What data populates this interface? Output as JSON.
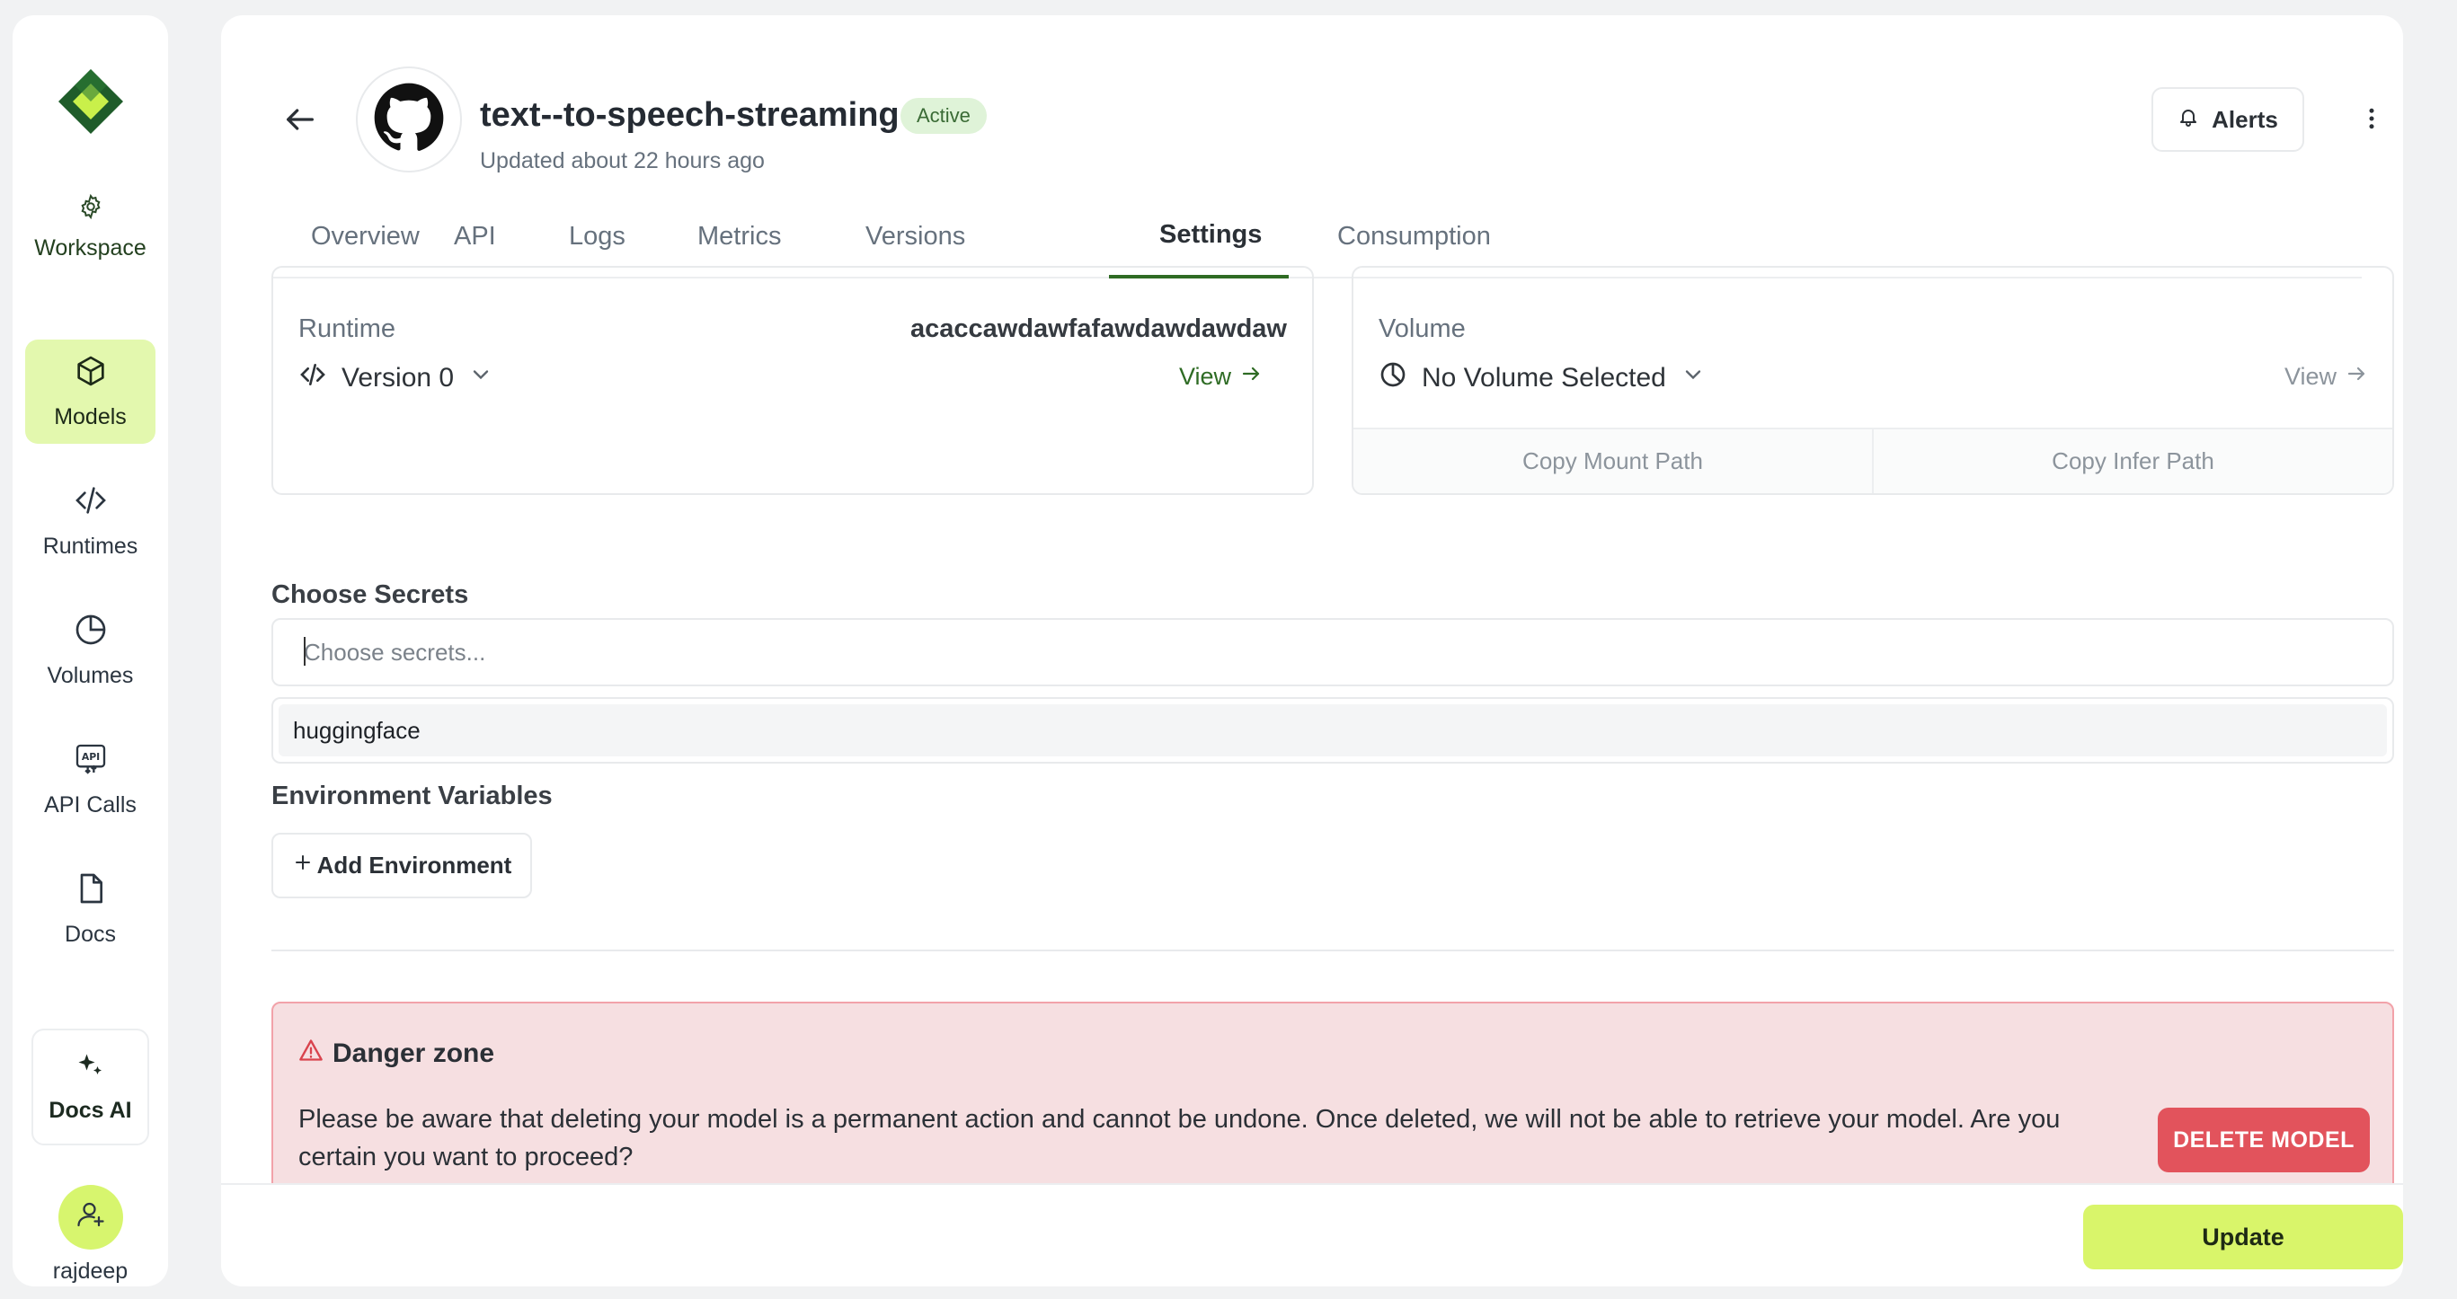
{
  "colors": {
    "accent": "#d9f56a",
    "active_nav_bg": "#e3f8ae",
    "brand_green": "#2f6b24",
    "danger_bg": "#f6dfe1",
    "danger_button": "#e2535c"
  },
  "sidebar": {
    "workspace_label": "Workspace",
    "items": [
      {
        "label": "Models",
        "icon": "cube-icon",
        "active": true
      },
      {
        "label": "Runtimes",
        "icon": "code-icon",
        "active": false
      },
      {
        "label": "Volumes",
        "icon": "pie-chart-icon",
        "active": false
      },
      {
        "label": "API Calls",
        "icon": "api-icon",
        "active": false
      },
      {
        "label": "Docs",
        "icon": "document-icon",
        "active": false
      }
    ],
    "docs_ai_label": "Docs AI",
    "user_name": "rajdeep"
  },
  "header": {
    "title": "text--to-speech-streaming",
    "status_badge": "Active",
    "subtitle": "Updated about 22 hours ago",
    "alerts_label": "Alerts"
  },
  "tabs": [
    "Overview",
    "API",
    "Logs",
    "Metrics",
    "Versions",
    "Settings",
    "Consumption"
  ],
  "active_tab": "Settings",
  "runtime_card": {
    "label": "Runtime",
    "runtime_id": "acaccawdawfafawdawdawdaw",
    "version": "Version 0",
    "view_label": "View"
  },
  "volume_card": {
    "label": "Volume",
    "selection": "No Volume Selected",
    "view_label": "View",
    "copy_mount_label": "Copy Mount Path",
    "copy_infer_label": "Copy Infer Path"
  },
  "secrets": {
    "label": "Choose Secrets",
    "placeholder": "Choose secrets...",
    "options": [
      "huggingface"
    ]
  },
  "env": {
    "label": "Environment Variables",
    "add_label": "Add Environment"
  },
  "danger_zone": {
    "title": "Danger zone",
    "text": "Please be aware that deleting your model is a permanent action and cannot be undone. Once deleted, we will not be able to retrieve your model. Are you certain you want to proceed?",
    "delete_label": "DELETE MODEL"
  },
  "footer": {
    "update_label": "Update"
  }
}
